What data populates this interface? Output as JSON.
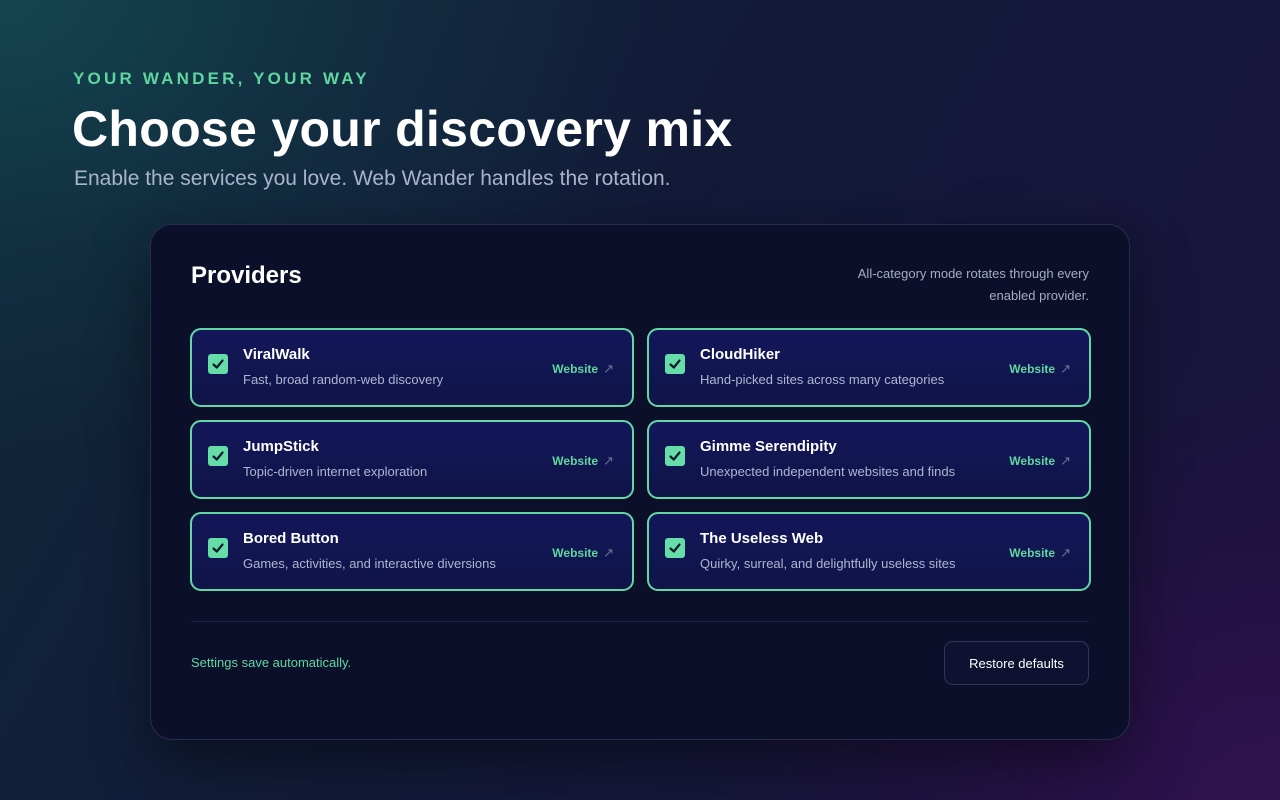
{
  "header": {
    "eyebrow": "YOUR WANDER, YOUR WAY",
    "title": "Choose your discovery mix",
    "subtitle": "Enable the services you love. Web Wander handles the rotation."
  },
  "panel": {
    "title": "Providers",
    "note": "All-category mode rotates through every enabled provider.",
    "providers": [
      {
        "name": "ViralWalk",
        "description": "Fast, broad random-web discovery",
        "link_label": "Website",
        "enabled": true
      },
      {
        "name": "CloudHiker",
        "description": "Hand-picked sites across many categories",
        "link_label": "Website",
        "enabled": true
      },
      {
        "name": "JumpStick",
        "description": "Topic-driven internet exploration",
        "link_label": "Website",
        "enabled": true
      },
      {
        "name": "Gimme Serendipity",
        "description": "Unexpected independent websites and finds",
        "link_label": "Website",
        "enabled": true
      },
      {
        "name": "Bored Button",
        "description": "Games, activities, and interactive diversions",
        "link_label": "Website",
        "enabled": true
      },
      {
        "name": "The Useless Web",
        "description": "Quirky, surreal, and delightfully useless sites",
        "link_label": "Website",
        "enabled": true
      }
    ],
    "link_icon": "external-arrow-icon",
    "check_icon": "checkmark-icon",
    "footer": {
      "save_note": "Settings save automatically.",
      "restore_label": "Restore defaults"
    }
  },
  "colors": {
    "accent": "#5fd6a0",
    "panel_bg": "#0c0f2a",
    "card_bg": "#13175a"
  }
}
